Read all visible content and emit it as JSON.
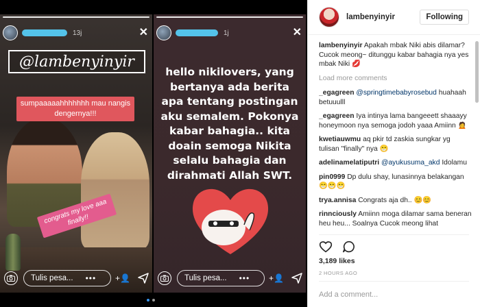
{
  "story1": {
    "time": "13j",
    "handle": "@lambenyinyir",
    "caption_red": "sumpaaaaahhhhhhh mau nangis dengernya!!!",
    "caption_pink": "congrats my love aaa finally!!",
    "reply_placeholder": "Tulis pesa...",
    "more": "•••"
  },
  "story2": {
    "time": "1j",
    "text": "hello nikilovers, yang bertanya ada berita apa tentang postingan aku semalem. Pokonya kabar bahagia.. kita doain semoga Nikita selalu bahagia dan dirahmati Allah SWT.",
    "reply_placeholder": "Tulis pesa...",
    "more": "•••"
  },
  "post": {
    "username": "lambenyinyir",
    "follow_label": "Following",
    "caption_user": "lambenyinyir",
    "caption_text": "Apakah mbak Niki abis dilamar? Cucok meong~ ditunggu kabar bahagia nya yes mbak Niki 💋",
    "load_more": "Load more comments",
    "comments": [
      {
        "user": "_egagreen",
        "mention": "@springtimebabyrosebud",
        "text": "huahaah betuuulll"
      },
      {
        "user": "_egagreen",
        "mention": "",
        "text": "Iya intinya lama bangeeett shaaayy honeymoon nya semoga jodoh yaaa Amiinn 🙍"
      },
      {
        "user": "kwetiauwmu",
        "mention": "",
        "text": "aq pkir td zaskia sungkar yg tulisan \"finally\" nya 😁"
      },
      {
        "user": "adelinamelatiputri",
        "mention": "@ayukusuma_akd",
        "text": "Idolamu"
      },
      {
        "user": "pin0999",
        "mention": "",
        "text": "Dp dulu shay, lunasinnya belakangan😁😁😁"
      },
      {
        "user": "trya.annisa",
        "mention": "",
        "text": "Congrats aja dh.. 😊😊"
      },
      {
        "user": "rinnciously",
        "mention": "",
        "text": "Amiinn moga dilamar sama beneran heu heu... Soalnya Cucok meong lihat"
      }
    ],
    "likes": "3,189 likes",
    "ago": "2 HOURS AGO",
    "add_comment_placeholder": "Add a comment..."
  }
}
